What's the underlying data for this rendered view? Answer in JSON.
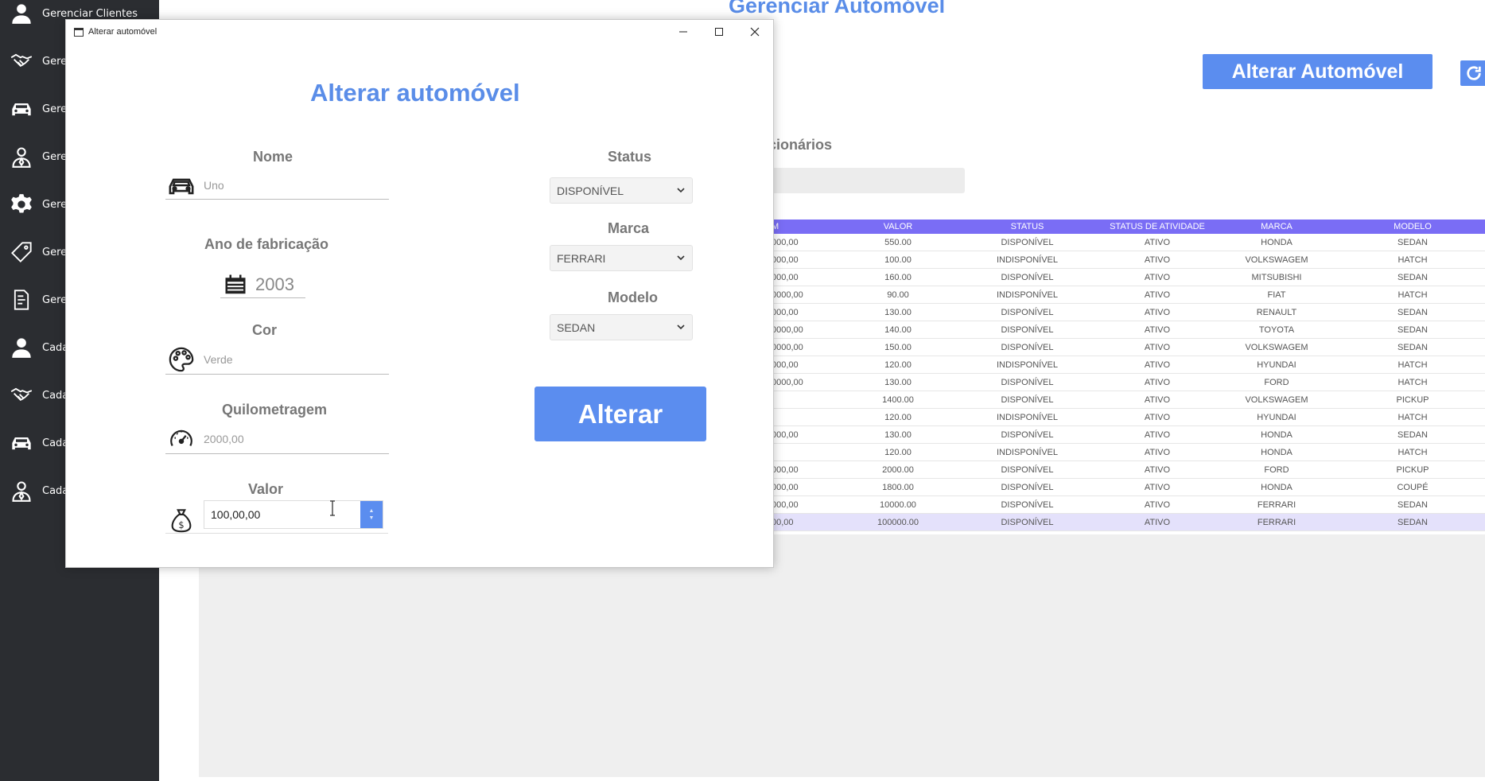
{
  "sidebar": {
    "items": [
      {
        "label": "Gerenciar Clientes",
        "icon": "user-icon"
      },
      {
        "label": "Gere",
        "icon": "handshake-icon"
      },
      {
        "label": "Gere",
        "icon": "car-icon"
      },
      {
        "label": "Gere",
        "icon": "employee-icon"
      },
      {
        "label": "Gere",
        "icon": "gear-icon"
      },
      {
        "label": "Gere",
        "icon": "tag-icon"
      },
      {
        "label": "Gere",
        "icon": "report-icon"
      },
      {
        "label": "Cada",
        "icon": "user-icon"
      },
      {
        "label": "Cada",
        "icon": "handshake-icon"
      },
      {
        "label": "Cada",
        "icon": "car-icon"
      },
      {
        "label": "Cada",
        "icon": "employee-icon"
      }
    ]
  },
  "background": {
    "title": "Gerenciar Automóvel",
    "alter_button": "Alterar Automóvel",
    "section_label": "cionários",
    "table": {
      "headers": [
        "M",
        "VALOR",
        "STATUS",
        "STATUS DE ATIVIDADE",
        "MARCA",
        "MODELO"
      ],
      "rows": [
        [
          "000,00",
          "550.00",
          "DISPONÍVEL",
          "ATIVO",
          "HONDA",
          "SEDAN"
        ],
        [
          "000,00",
          "100.00",
          "INDISPONÍVEL",
          "ATIVO",
          "VOLKSWAGEM",
          "HATCH"
        ],
        [
          "000,00",
          "160.00",
          "DISPONÍVEL",
          "ATIVO",
          "MITSUBISHI",
          "SEDAN"
        ],
        [
          "0000,00",
          "90.00",
          "INDISPONÍVEL",
          "ATIVO",
          "FIAT",
          "HATCH"
        ],
        [
          "000,00",
          "130.00",
          "DISPONÍVEL",
          "ATIVO",
          "RENAULT",
          "SEDAN"
        ],
        [
          "0000,00",
          "140.00",
          "DISPONÍVEL",
          "ATIVO",
          "TOYOTA",
          "SEDAN"
        ],
        [
          "0000,00",
          "150.00",
          "DISPONÍVEL",
          "ATIVO",
          "VOLKSWAGEM",
          "SEDAN"
        ],
        [
          "000,00",
          "120.00",
          "INDISPONÍVEL",
          "ATIVO",
          "HYUNDAI",
          "HATCH"
        ],
        [
          "0000,00",
          "130.00",
          "DISPONÍVEL",
          "ATIVO",
          "FORD",
          "HATCH"
        ],
        [
          "",
          "1400.00",
          "DISPONÍVEL",
          "ATIVO",
          "VOLKSWAGEM",
          "PICKUP"
        ],
        [
          "",
          "120.00",
          "INDISPONÍVEL",
          "ATIVO",
          "HYUNDAI",
          "HATCH"
        ],
        [
          "000,00",
          "130.00",
          "DISPONÍVEL",
          "ATIVO",
          "HONDA",
          "SEDAN"
        ],
        [
          "",
          "120.00",
          "INDISPONÍVEL",
          "ATIVO",
          "HONDA",
          "HATCH"
        ],
        [
          "000,00",
          "2000.00",
          "DISPONÍVEL",
          "ATIVO",
          "FORD",
          "PICKUP"
        ],
        [
          "000,00",
          "1800.00",
          "DISPONÍVEL",
          "ATIVO",
          "HONDA",
          "COUPÉ"
        ],
        [
          "000,00",
          "10000.00",
          "DISPONÍVEL",
          "ATIVO",
          "FERRARI",
          "SEDAN"
        ],
        [
          "00,00",
          "100000.00",
          "DISPONÍVEL",
          "ATIVO",
          "FERRARI",
          "SEDAN"
        ]
      ]
    }
  },
  "dialog": {
    "window_title": "Alterar automóvel",
    "heading": "Alterar automóvel",
    "labels": {
      "nome": "Nome",
      "ano": "Ano de fabricação",
      "cor": "Cor",
      "quilometragem": "Quilometragem",
      "valor": "Valor",
      "status": "Status",
      "marca": "Marca",
      "modelo": "Modelo"
    },
    "values": {
      "nome": "Uno",
      "ano": "2003",
      "cor": "Verde",
      "quilometragem": "2000,00",
      "valor": "100,00,00",
      "status": "DISPONÍVEL",
      "marca": "FERRARI",
      "modelo": "SEDAN"
    },
    "submit": "Alterar"
  },
  "colors": {
    "accent": "#5b8def",
    "title_blue": "#5a8de8",
    "sidebar_bg": "#2b2d31",
    "table_header": "#7a6df5"
  }
}
